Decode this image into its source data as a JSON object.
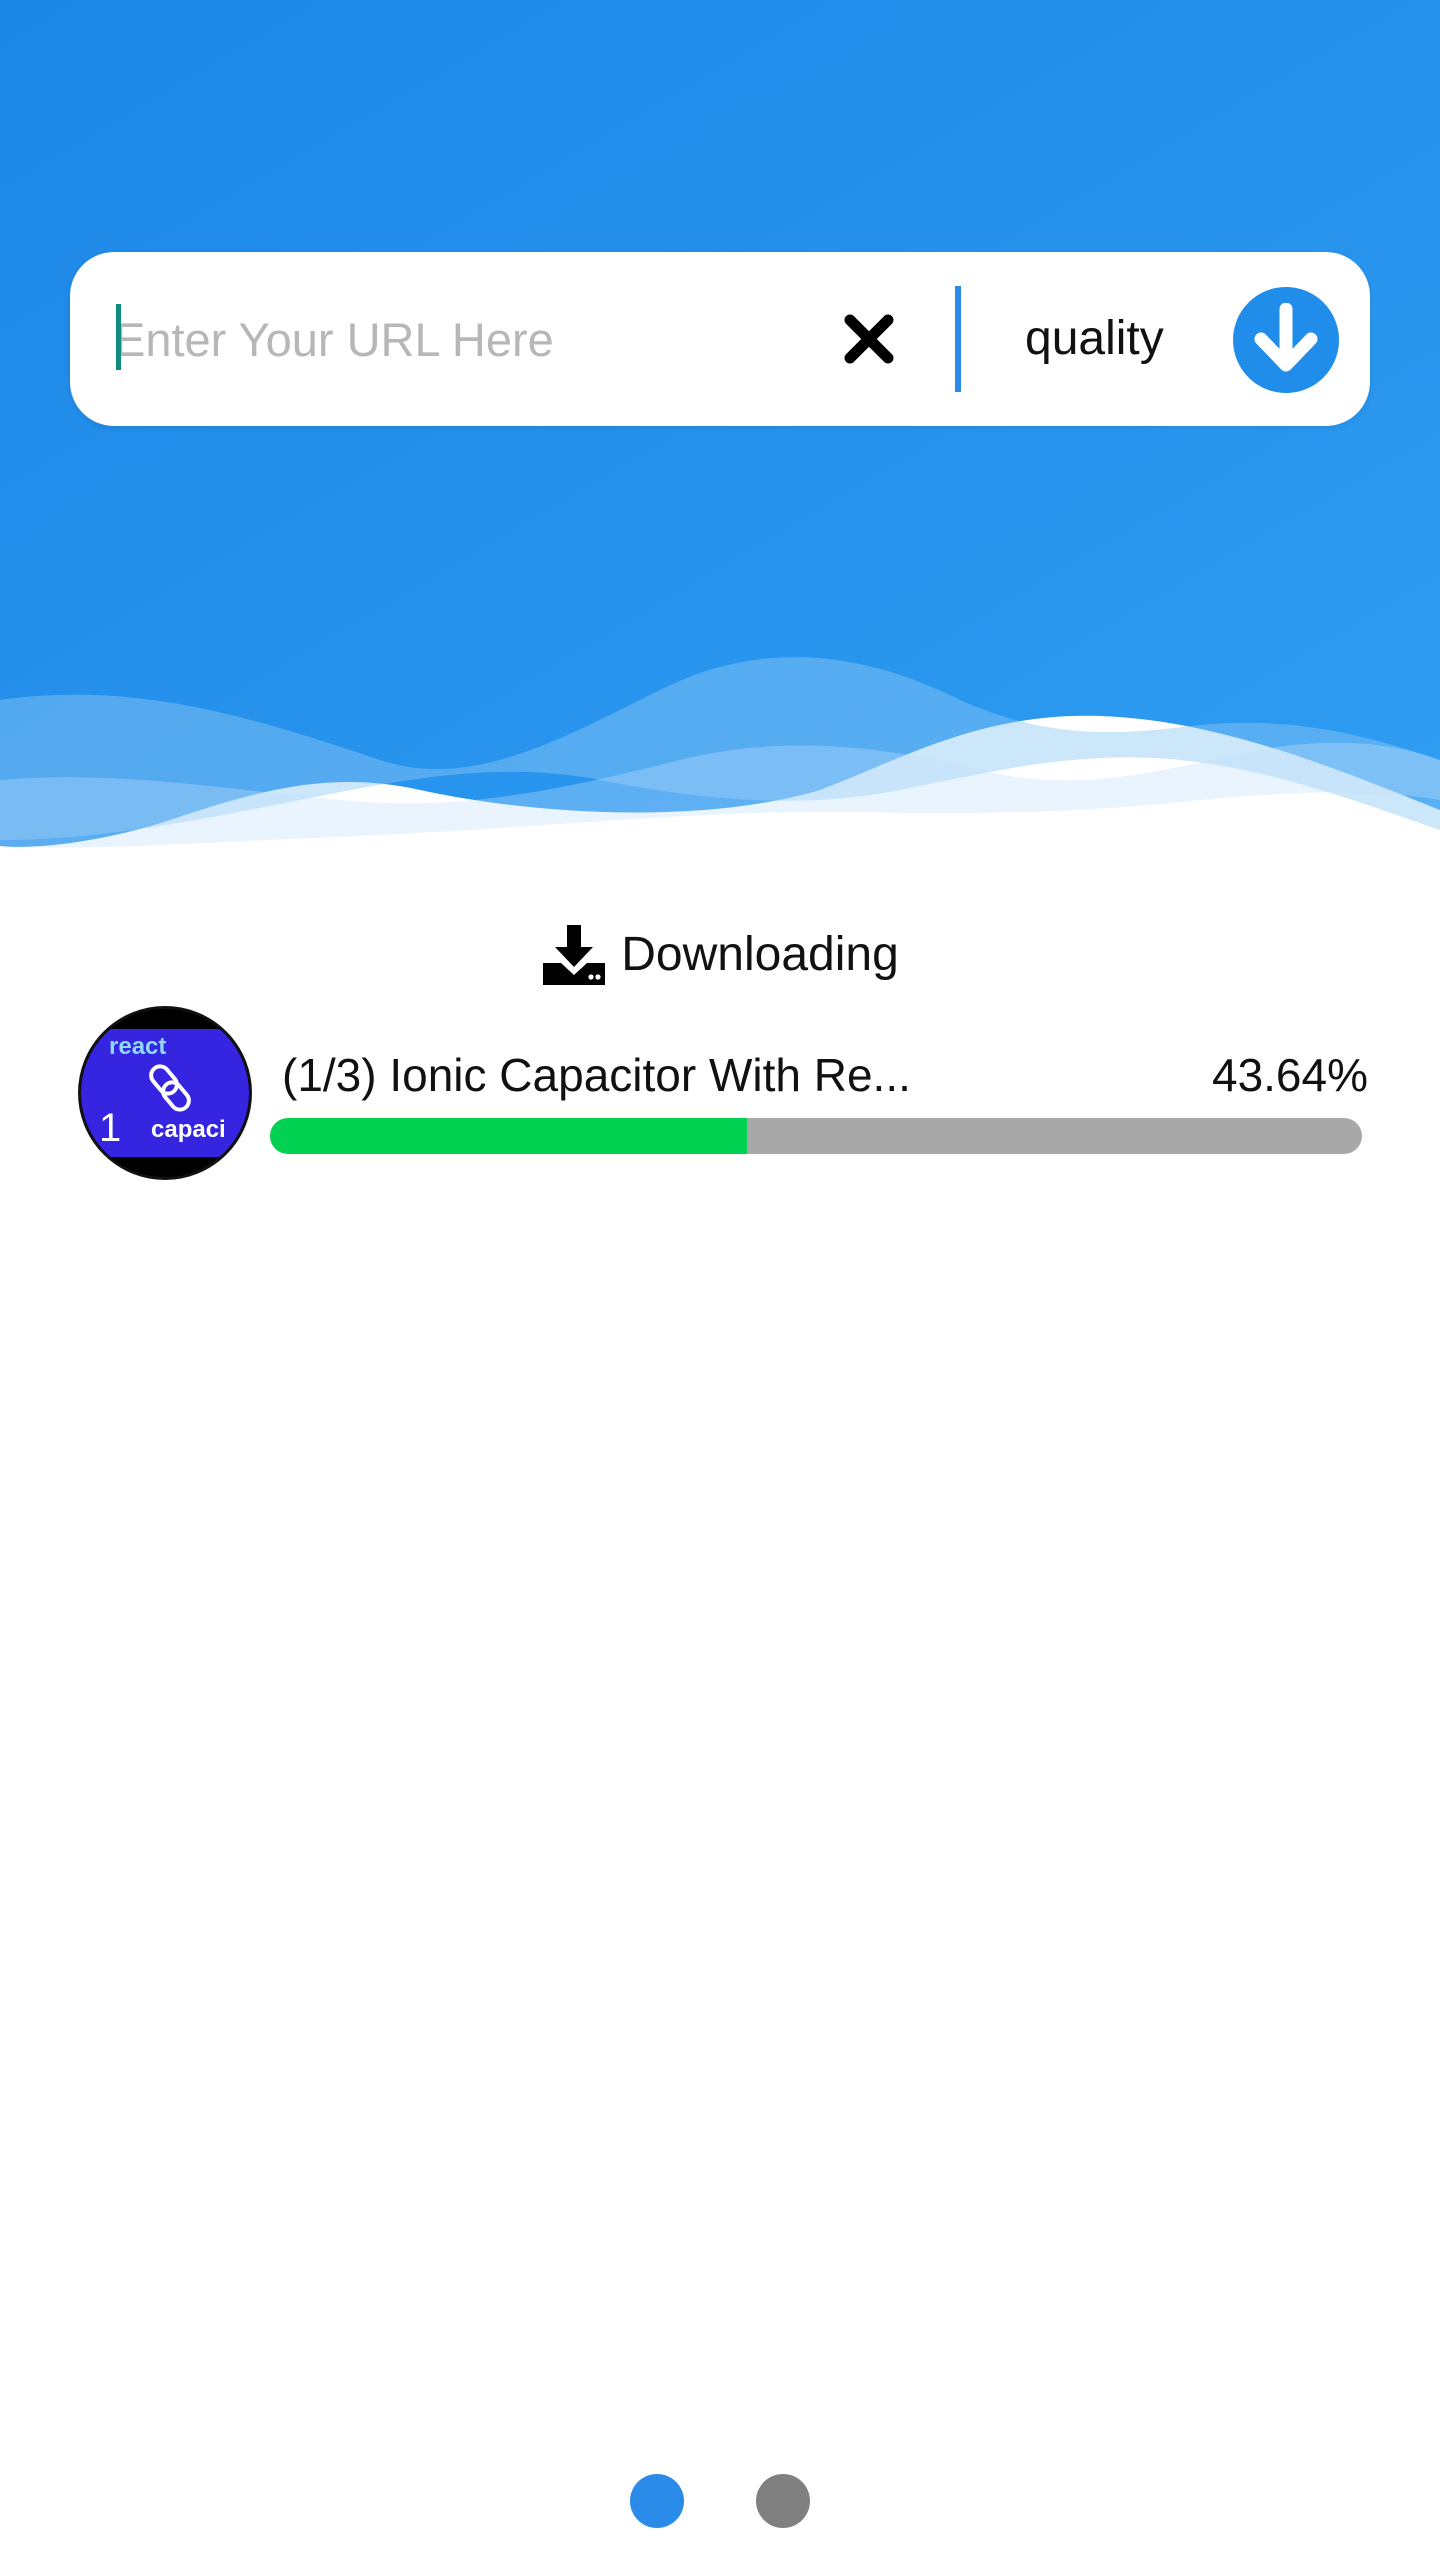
{
  "colors": {
    "brand_blue": "#1f8de9",
    "progress_fill": "#00d150",
    "progress_track": "#a8a8a8",
    "dot_active": "#2a8be8",
    "dot_inactive": "#808080"
  },
  "search": {
    "placeholder": "Enter Your URL Here",
    "value": "",
    "clear_icon": "close-icon",
    "quality_label": "quality",
    "download_icon": "download-arrow-icon"
  },
  "downloads": {
    "heading_icon": "download-tray-icon",
    "heading": "Downloading",
    "items": [
      {
        "title": "(1/3) Ionic Capacitor With Re...",
        "percent_text": "43.64%",
        "progress": 0.4364,
        "thumbnail": {
          "top_text": "react",
          "number": "1",
          "bottom_text": "capaci"
        }
      }
    ]
  },
  "pager": {
    "pages": 2,
    "active_index": 0
  }
}
